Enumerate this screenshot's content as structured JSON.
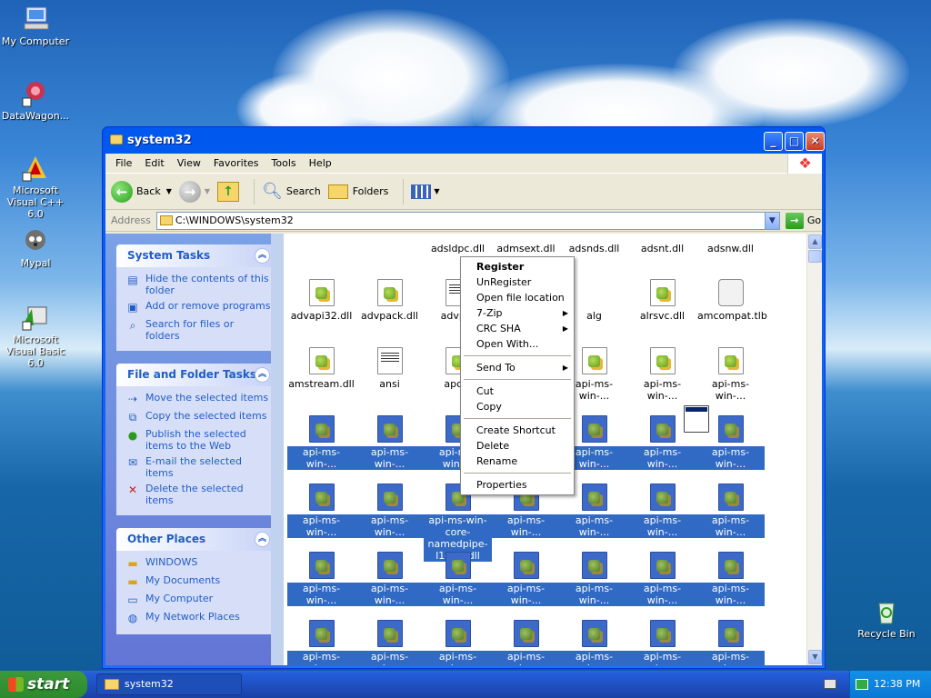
{
  "desktop": {
    "icons": [
      {
        "label": "My Computer",
        "icon": "my-computer-icon"
      },
      {
        "label": "DataWagon...",
        "icon": "datawagon-icon"
      },
      {
        "label": "Microsoft Visual C++ 6.0",
        "icon": "visual-cpp-icon"
      },
      {
        "label": "Mypal",
        "icon": "mypal-icon"
      },
      {
        "label": "Microsoft Visual Basic 6.0",
        "icon": "visual-basic-icon"
      },
      {
        "label": "Recycle Bin",
        "icon": "recycle-bin-icon"
      }
    ]
  },
  "window": {
    "title": "system32",
    "menu": [
      "File",
      "Edit",
      "View",
      "Favorites",
      "Tools",
      "Help"
    ],
    "toolbar": {
      "back": "Back",
      "search": "Search",
      "folders": "Folders"
    },
    "address": {
      "label": "Address",
      "value": "C:\\WINDOWS\\system32",
      "go": "Go"
    }
  },
  "taskpane": {
    "system_tasks": {
      "title": "System Tasks",
      "items": [
        "Hide the contents of this folder",
        "Add or remove programs",
        "Search for files or folders"
      ]
    },
    "file_tasks": {
      "title": "File and Folder Tasks",
      "items": [
        "Move the selected items",
        "Copy the selected items",
        "Publish the selected items to the Web",
        "E-mail the selected items",
        "Delete the selected items"
      ]
    },
    "other_places": {
      "title": "Other Places",
      "items": [
        "WINDOWS",
        "My Documents",
        "My Computer",
        "My Network Places"
      ]
    }
  },
  "files": {
    "row0": [
      "adsldpc.dll",
      "admsext.dll",
      "adsnds.dll",
      "adsnt.dll",
      "adsnw.dll"
    ],
    "row1": [
      "advapi32.dll",
      "advpack.dll",
      "advp...",
      "alg",
      "alrsvc.dll",
      "amcompat.tlb"
    ],
    "row2": [
      "amstream.dll",
      "ansi",
      "apc...",
      "api-ms-win-...",
      "api-ms-win-...",
      "api-ms-win-..."
    ],
    "selected_label": "api-ms-win-...",
    "expanded_label": "api-ms-win-core-namedpipe-l1-1-0.dll",
    "row3_partial": "api-ms-"
  },
  "context_menu": {
    "items": [
      {
        "label": "Register",
        "bold": true
      },
      {
        "label": "UnRegister"
      },
      {
        "label": "Open file location"
      },
      {
        "label": "7-Zip",
        "sub": true
      },
      {
        "label": "CRC SHA",
        "sub": true
      },
      {
        "label": "Open With..."
      },
      {
        "sep": true
      },
      {
        "label": "Send To",
        "sub": true
      },
      {
        "sep": true
      },
      {
        "label": "Cut"
      },
      {
        "label": "Copy"
      },
      {
        "sep": true
      },
      {
        "label": "Create Shortcut"
      },
      {
        "label": "Delete"
      },
      {
        "label": "Rename"
      },
      {
        "sep": true
      },
      {
        "label": "Properties"
      }
    ]
  },
  "taskbar": {
    "start": "start",
    "item": "system32",
    "clock": "12:38 PM"
  }
}
